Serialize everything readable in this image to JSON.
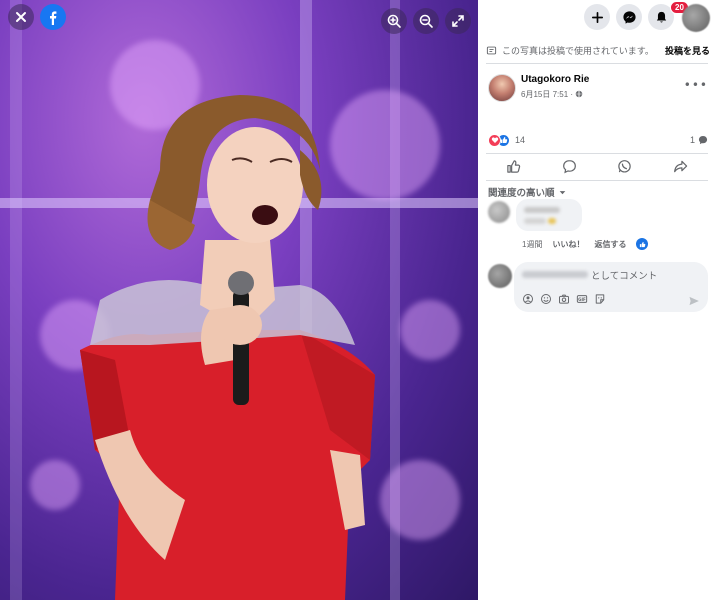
{
  "viewer": {
    "close_icon": "close-icon",
    "logo_icon": "facebook-logo-icon",
    "tools": [
      "zoom-in-icon",
      "zoom-out-icon",
      "fullscreen-icon"
    ]
  },
  "topbar": {
    "notification_count": "20"
  },
  "notice": {
    "text": "この写真は投稿で使用されています。",
    "link": "投稿を見る"
  },
  "post": {
    "author": "Utagokoro Rie",
    "date": "6月15日 7:51 ·",
    "reaction_count": "14",
    "comment_count": "1"
  },
  "comments": {
    "sort_label": "関連度の高い順",
    "items": [
      {
        "age": "1週間",
        "like_label": "いいね！",
        "reply_label": "返信する"
      }
    ],
    "composer_placeholder": "としてコメント"
  },
  "colors": {
    "accent": "#1b74e4",
    "badge": "#e41e3f",
    "heart": "#f33e58"
  }
}
